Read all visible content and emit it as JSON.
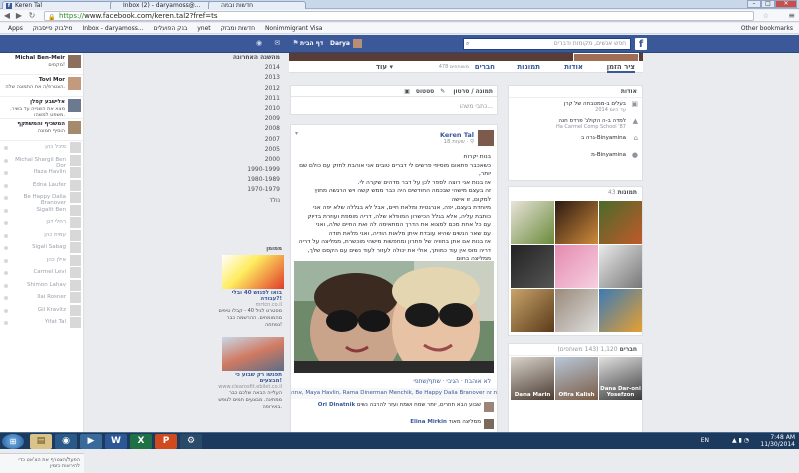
{
  "browser": {
    "tabs": [
      "Keren Tal",
      "Inbox (2) - daryamoss@...",
      "חדשות ובמה"
    ],
    "url_https": "https://",
    "url_rest": "www.facebook.com/keren.tal2?fref=ts",
    "bookmarks": [
      "Apps",
      "מילבוק פייסבוק",
      "Inbox - daryamoss...",
      "בנק הפועלים",
      "ynet",
      "חדשות ומבזק",
      "Nonimmigrant Visa"
    ],
    "other_bookmarks": "Other bookmarks"
  },
  "fb": {
    "search_placeholder": "חפש אנשים, מקומות ודברים",
    "user_name": "Darya",
    "home_label": "דף הבית",
    "icons_glyphs": "◉ ✉ ⚑"
  },
  "profile_tabs": {
    "timeline": "ציר הזמן",
    "about": "אודות",
    "photos": "תמונות",
    "friends": "חברים",
    "friends_count": "478 משותפים",
    "more": "עוד ▾"
  },
  "left_sidebar": {
    "close_friends": [
      {
        "name": "Michal Ben-Meir",
        "sub": "מקסים!"
      },
      {
        "name": "Tovi Mor",
        "sub": "הצטרפ/ה את התמונה שלה."
      },
      {
        "name": "אלישבע קפלן",
        "sub": "מצא את השנייה עד בשיר. משפט למשהו."
      },
      {
        "name": "המשכיף והמשתקף",
        "sub": "הוסיף תמונה"
      }
    ],
    "chat_names": [
      "מיכל כהן",
      "Michal Shargil Ben Dor",
      "Ifaza Havlin",
      "Edna Laufer",
      "Be Happy Dalia Branover",
      "Sigalit Ben",
      "רחלי דגן",
      "עמית כהן",
      "Sigali Sabag",
      "אילן כהן",
      "Carmel Levi",
      "Shimon Lahav",
      "Ilai Rosner",
      "Gil Kravitz",
      "Yifat Tal"
    ],
    "chat_box": "הפעל/הצטרף את הצ'אט כדי להיראות כזמין"
  },
  "timeline_years": [
    "מהשנה האחרונה",
    "2014",
    "2013",
    "2012",
    "2011",
    "2010",
    "2009",
    "2008",
    "2007",
    "2005",
    "2000",
    "1990-1999",
    "1980-1989",
    "1970-1979",
    "נולד"
  ],
  "sponsored": {
    "header": "ממומן",
    "ads": [
      {
        "title": "בואו לפגוש 40 ובלי עבודה?!",
        "text": "מסטרט לגיל 40 - קבלו טיפים מהמומחים. ההרשמה כבר נפתחה!",
        "link": "mrtcn.co.il"
      },
      {
        "title": "תפגשו רק שבוע כי מבצעים!",
        "text": "העלייה הבאה שלכם כבר ממתינה. מבצעים חמים לנופש באירופה.",
        "link": "www.clearosfit.ebilet.co.il"
      }
    ]
  },
  "composer": {
    "tabs": [
      "סטטוס",
      "תמונה / סרטון"
    ],
    "placeholder": "כתבי משהו..."
  },
  "post": {
    "author": "Keren Tal",
    "time": "18 שעות · ⚲",
    "text_lines": [
      "בנות יקרות",
      "כשאכבר פתאום מוסיפי פרשים לי דברים טובים אני אוהבת לחזק עם כולם שם יותר,",
      "אז בנות אני רוצה לספר לכן על דבר מדהים שקרה לי.",
      "זה בעצם מישהי שבכמה החודשים היה כבר ממש קשה ויש הרגשה מחוץ למקום, זו אישה",
      "מיוחדת בעצם, יפה, אנרגטית ומלאת חיים, אבל לא בגללה שלא יפה אני",
      "כותבת עליה, אלא בגלל הכישרון המופלא שלה, דריה מוספת ועוזרת בדיוק",
      "עם כל אחת מכם למצוא את הדרך המתאימה לה ואת החיים שלה, ואני",
      "עם שאר הנשים שהיא עובדת איתן מלאות הודיה, ואני מלאת תודה",
      "אז בנות אם אתן בחוויה של פתרון ומחפשות מישהי מוכשרת, ממליצה על דריה",
      "דריה מוס אין עוד כמותך, אולי את יכולה לעזור לעוד נשים עם הקסם שלך,",
      "ממליצה בחום",
      "קרן טל - ממטבחה של קרן, בנימינה"
    ],
    "actions": "לא אוהבת · הגיבי · שתף/שתפי",
    "likes": "אתה, Maya Havlin, Rama Dinerman Menchik, Be Happy Dalia Branover ו-19 אחרים אוהבים את זה.",
    "comments": [
      {
        "author": "Ori Dinatnik",
        "text": "שבוע הבא חוזרים, יותר שמח ושמח ועזר להרבה נשים"
      },
      {
        "author": "Elina Mirkin",
        "text": "ממליצה מאוד"
      }
    ]
  },
  "about": {
    "header": "אודות",
    "items": [
      {
        "t1": "בעלים ב-ממטבחה של קרן",
        "t2": "2014 עד היום"
      },
      {
        "t1": "למדה ב-ה הקולג' פרדס חנה",
        "t2": "Ha Carmel Comp School '87"
      },
      {
        "t1": "גרה ב-Binyamina",
        "t2": ""
      },
      {
        "t1": "מ-Binyamina",
        "t2": ""
      }
    ]
  },
  "photos": {
    "header": "תמונות",
    "count": "43"
  },
  "friends": {
    "header": "חברים",
    "count": "1,120 (143 משותפים)",
    "names": [
      "Dana Marin",
      "Ofira Kalish",
      "Dana Dar-oni Yosefzon"
    ]
  },
  "taskbar": {
    "lang": "EN",
    "time": "7:48 AM",
    "date": "11/30/2014"
  }
}
